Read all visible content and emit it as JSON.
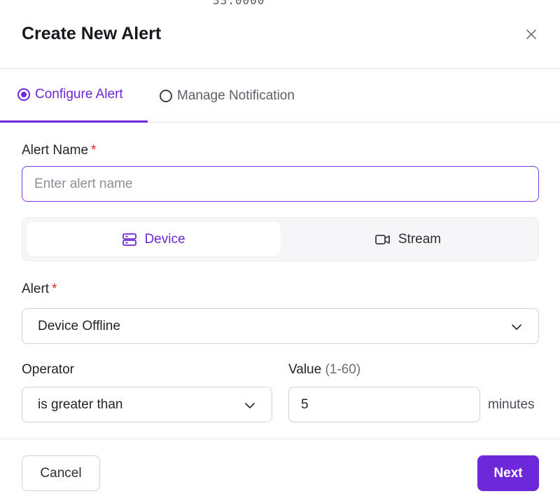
{
  "backdrop": {
    "glyph_text": "33.0000"
  },
  "header": {
    "title": "Create New Alert",
    "close_icon": "close-icon"
  },
  "tabs": [
    {
      "label": "Configure Alert",
      "active": true
    },
    {
      "label": "Manage Notification",
      "active": false
    }
  ],
  "form": {
    "alert_name": {
      "label": "Alert Name",
      "required_mark": "*",
      "value": "",
      "placeholder": "Enter alert name"
    },
    "source_toggle": {
      "options": [
        {
          "label": "Device",
          "icon": "server-icon",
          "selected": true
        },
        {
          "label": "Stream",
          "icon": "video-camera-icon",
          "selected": false
        }
      ]
    },
    "alert": {
      "label": "Alert",
      "required_mark": "*",
      "selected": "Device Offline"
    },
    "operator": {
      "label": "Operator",
      "selected": "is greater than"
    },
    "value": {
      "label": "Value",
      "range": "(1-60)",
      "value": "5",
      "unit": "minutes"
    }
  },
  "footer": {
    "cancel_label": "Cancel",
    "next_label": "Next"
  },
  "colors": {
    "accent": "#6d28d9",
    "required": "#dc2626",
    "border": "#cfd2d8"
  }
}
